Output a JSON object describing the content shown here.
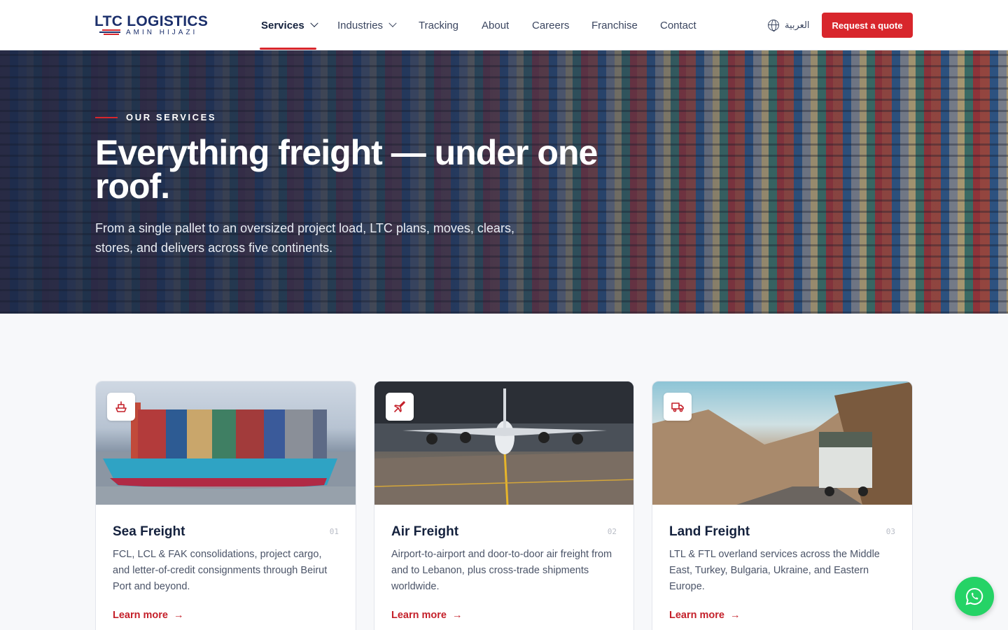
{
  "header": {
    "logo": {
      "main": "LTC LOGISTICS",
      "sub": "AMIN HIJAZI"
    },
    "nav": [
      {
        "label": "Services",
        "active": true,
        "dropdown": true
      },
      {
        "label": "Industries",
        "active": false,
        "dropdown": true
      },
      {
        "label": "Tracking",
        "active": false,
        "dropdown": false
      },
      {
        "label": "About",
        "active": false,
        "dropdown": false
      },
      {
        "label": "Careers",
        "active": false,
        "dropdown": false
      },
      {
        "label": "Franchise",
        "active": false,
        "dropdown": false
      },
      {
        "label": "Contact",
        "active": false,
        "dropdown": false
      }
    ],
    "language_label": "العربية",
    "quote_button": "Request a quote"
  },
  "hero": {
    "eyebrow": "OUR SERVICES",
    "title": "Everything freight — under one roof.",
    "subtitle": "From a single pallet to an oversized project load, LTC plans, moves, clears, stores, and delivers across five continents."
  },
  "cards": [
    {
      "title": "Sea Freight",
      "number": "01",
      "icon": "ship-icon",
      "description": "FCL, LCL & FAK consolidations, project cargo, and letter-of-credit consignments through Beirut Port and beyond.",
      "link": "Learn more"
    },
    {
      "title": "Air Freight",
      "number": "02",
      "icon": "plane-icon",
      "description": "Airport-to-airport and door-to-door air freight from and to Lebanon, plus cross-trade shipments worldwide.",
      "link": "Learn more"
    },
    {
      "title": "Land Freight",
      "number": "03",
      "icon": "truck-icon",
      "description": "LTL & FTL overland services across the Middle East, Turkey, Bulgaria, Ukraine, and Eastern Europe.",
      "link": "Learn more"
    }
  ],
  "colors": {
    "accent": "#d8262c",
    "navy": "#1b2f6b",
    "whatsapp": "#25d366"
  }
}
